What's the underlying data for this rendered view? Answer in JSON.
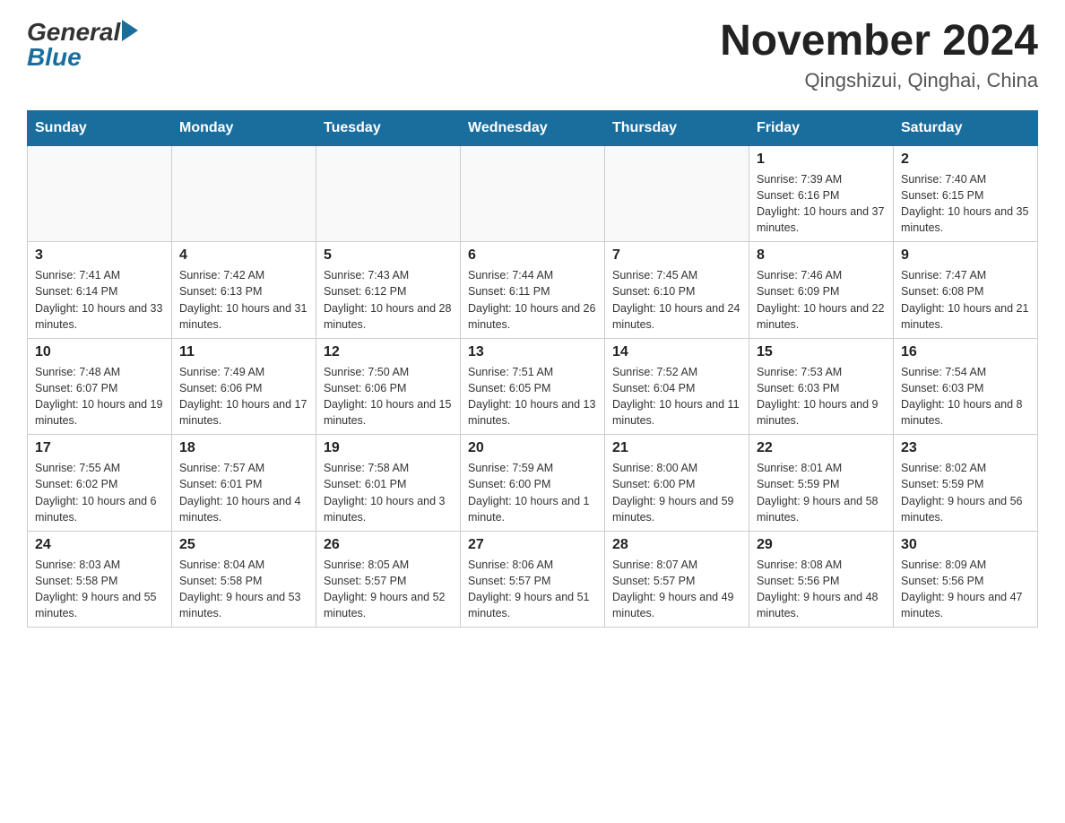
{
  "header": {
    "logo": {
      "general_text": "General",
      "blue_text": "Blue"
    },
    "title": "November 2024",
    "subtitle": "Qingshizui, Qinghai, China"
  },
  "days_of_week": [
    "Sunday",
    "Monday",
    "Tuesday",
    "Wednesday",
    "Thursday",
    "Friday",
    "Saturday"
  ],
  "weeks": [
    [
      {
        "day": "",
        "info": ""
      },
      {
        "day": "",
        "info": ""
      },
      {
        "day": "",
        "info": ""
      },
      {
        "day": "",
        "info": ""
      },
      {
        "day": "",
        "info": ""
      },
      {
        "day": "1",
        "info": "Sunrise: 7:39 AM\nSunset: 6:16 PM\nDaylight: 10 hours and 37 minutes."
      },
      {
        "day": "2",
        "info": "Sunrise: 7:40 AM\nSunset: 6:15 PM\nDaylight: 10 hours and 35 minutes."
      }
    ],
    [
      {
        "day": "3",
        "info": "Sunrise: 7:41 AM\nSunset: 6:14 PM\nDaylight: 10 hours and 33 minutes."
      },
      {
        "day": "4",
        "info": "Sunrise: 7:42 AM\nSunset: 6:13 PM\nDaylight: 10 hours and 31 minutes."
      },
      {
        "day": "5",
        "info": "Sunrise: 7:43 AM\nSunset: 6:12 PM\nDaylight: 10 hours and 28 minutes."
      },
      {
        "day": "6",
        "info": "Sunrise: 7:44 AM\nSunset: 6:11 PM\nDaylight: 10 hours and 26 minutes."
      },
      {
        "day": "7",
        "info": "Sunrise: 7:45 AM\nSunset: 6:10 PM\nDaylight: 10 hours and 24 minutes."
      },
      {
        "day": "8",
        "info": "Sunrise: 7:46 AM\nSunset: 6:09 PM\nDaylight: 10 hours and 22 minutes."
      },
      {
        "day": "9",
        "info": "Sunrise: 7:47 AM\nSunset: 6:08 PM\nDaylight: 10 hours and 21 minutes."
      }
    ],
    [
      {
        "day": "10",
        "info": "Sunrise: 7:48 AM\nSunset: 6:07 PM\nDaylight: 10 hours and 19 minutes."
      },
      {
        "day": "11",
        "info": "Sunrise: 7:49 AM\nSunset: 6:06 PM\nDaylight: 10 hours and 17 minutes."
      },
      {
        "day": "12",
        "info": "Sunrise: 7:50 AM\nSunset: 6:06 PM\nDaylight: 10 hours and 15 minutes."
      },
      {
        "day": "13",
        "info": "Sunrise: 7:51 AM\nSunset: 6:05 PM\nDaylight: 10 hours and 13 minutes."
      },
      {
        "day": "14",
        "info": "Sunrise: 7:52 AM\nSunset: 6:04 PM\nDaylight: 10 hours and 11 minutes."
      },
      {
        "day": "15",
        "info": "Sunrise: 7:53 AM\nSunset: 6:03 PM\nDaylight: 10 hours and 9 minutes."
      },
      {
        "day": "16",
        "info": "Sunrise: 7:54 AM\nSunset: 6:03 PM\nDaylight: 10 hours and 8 minutes."
      }
    ],
    [
      {
        "day": "17",
        "info": "Sunrise: 7:55 AM\nSunset: 6:02 PM\nDaylight: 10 hours and 6 minutes."
      },
      {
        "day": "18",
        "info": "Sunrise: 7:57 AM\nSunset: 6:01 PM\nDaylight: 10 hours and 4 minutes."
      },
      {
        "day": "19",
        "info": "Sunrise: 7:58 AM\nSunset: 6:01 PM\nDaylight: 10 hours and 3 minutes."
      },
      {
        "day": "20",
        "info": "Sunrise: 7:59 AM\nSunset: 6:00 PM\nDaylight: 10 hours and 1 minute."
      },
      {
        "day": "21",
        "info": "Sunrise: 8:00 AM\nSunset: 6:00 PM\nDaylight: 9 hours and 59 minutes."
      },
      {
        "day": "22",
        "info": "Sunrise: 8:01 AM\nSunset: 5:59 PM\nDaylight: 9 hours and 58 minutes."
      },
      {
        "day": "23",
        "info": "Sunrise: 8:02 AM\nSunset: 5:59 PM\nDaylight: 9 hours and 56 minutes."
      }
    ],
    [
      {
        "day": "24",
        "info": "Sunrise: 8:03 AM\nSunset: 5:58 PM\nDaylight: 9 hours and 55 minutes."
      },
      {
        "day": "25",
        "info": "Sunrise: 8:04 AM\nSunset: 5:58 PM\nDaylight: 9 hours and 53 minutes."
      },
      {
        "day": "26",
        "info": "Sunrise: 8:05 AM\nSunset: 5:57 PM\nDaylight: 9 hours and 52 minutes."
      },
      {
        "day": "27",
        "info": "Sunrise: 8:06 AM\nSunset: 5:57 PM\nDaylight: 9 hours and 51 minutes."
      },
      {
        "day": "28",
        "info": "Sunrise: 8:07 AM\nSunset: 5:57 PM\nDaylight: 9 hours and 49 minutes."
      },
      {
        "day": "29",
        "info": "Sunrise: 8:08 AM\nSunset: 5:56 PM\nDaylight: 9 hours and 48 minutes."
      },
      {
        "day": "30",
        "info": "Sunrise: 8:09 AM\nSunset: 5:56 PM\nDaylight: 9 hours and 47 minutes."
      }
    ]
  ]
}
